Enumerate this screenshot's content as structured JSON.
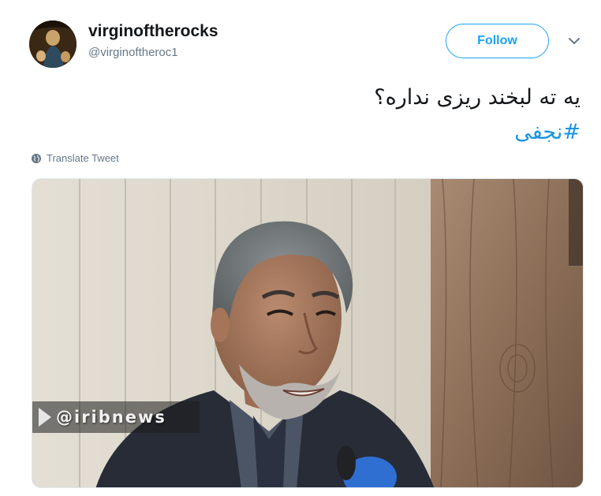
{
  "user": {
    "display_name": "virginoftherocks",
    "handle": "@virginoftheroc1"
  },
  "actions": {
    "follow_label": "Follow",
    "more_icon": "chevron-down-icon"
  },
  "tweet": {
    "text": "یه ته لبخند ریزی نداره؟",
    "hashtag": "#نجفی"
  },
  "translate": {
    "label": "Translate Tweet",
    "icon": "globe-icon"
  },
  "media": {
    "watermark": "@iribnews"
  },
  "colors": {
    "accent": "#1da1f2",
    "hashtag": "#1b95e0",
    "secondary_text": "#657786"
  }
}
